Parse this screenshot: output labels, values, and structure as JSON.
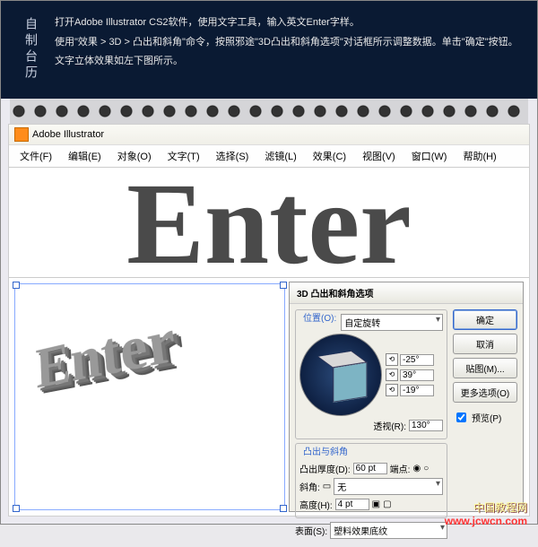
{
  "header": {
    "side": "自制台历",
    "p1": "打开Adobe Illustrator CS2软件，使用文字工具，输入英文Enter字样。",
    "p2": "使用\"效果 > 3D > 凸出和斜角\"命令，按照邪途\"3D凸出和斜角选项\"对话框所示调整数据。单击\"确定\"按钮。",
    "p3": "文字立体效果如左下图所示。"
  },
  "app": {
    "title": "Adobe Illustrator",
    "menu": [
      "文件(F)",
      "编辑(E)",
      "对象(O)",
      "文字(T)",
      "选择(S)",
      "滤镜(L)",
      "效果(C)",
      "视图(V)",
      "窗口(W)",
      "帮助(H)"
    ],
    "bigText": "Enter",
    "art3d": "Enter"
  },
  "dialog": {
    "title": "3D 凸出和斜角选项",
    "pos_legend": "位置(O):",
    "pos_value": "自定旋转",
    "angle1": "-25°",
    "angle2": "39°",
    "angle3": "-19°",
    "persp_label": "透视(R):",
    "persp_value": "130°",
    "extrude_legend": "凸出与斜角",
    "depth_label": "凸出厚度(D):",
    "depth_value": "60 pt",
    "cap_label": "端点:",
    "bevel_label": "斜角:",
    "bevel_value": "无",
    "height_label": "高度(H):",
    "height_value": "4 pt",
    "surface_label": "表面(S):",
    "surface_value": "塑料效果底纹",
    "ok": "确定",
    "cancel": "取消",
    "map": "贴图(M)...",
    "more": "更多选项(O)",
    "preview": "预览(P)"
  },
  "watermark": {
    "l1": "中国教程网",
    "l2": "www.jcwcn.com"
  }
}
